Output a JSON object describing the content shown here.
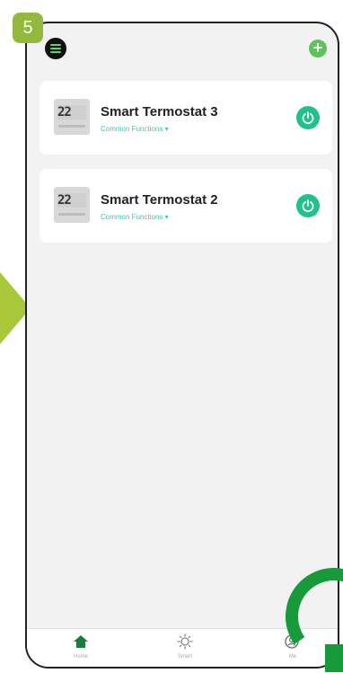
{
  "step": {
    "number": "5"
  },
  "devices": [
    {
      "name": "Smart Termostat 3",
      "display": "22",
      "functions_label": "Common Functions ▾"
    },
    {
      "name": "Smart Termostat 2",
      "display": "22",
      "functions_label": "Common Functions ▾"
    }
  ],
  "tabs": [
    {
      "label": "Home",
      "icon": "home-icon"
    },
    {
      "label": "Smart",
      "icon": "smart-sun-icon"
    },
    {
      "label": "Me",
      "icon": "profile-icon"
    }
  ],
  "colors": {
    "accent": "#21c18a",
    "step_badge": "#93b83c",
    "functions_text": "#3cc7b7"
  }
}
